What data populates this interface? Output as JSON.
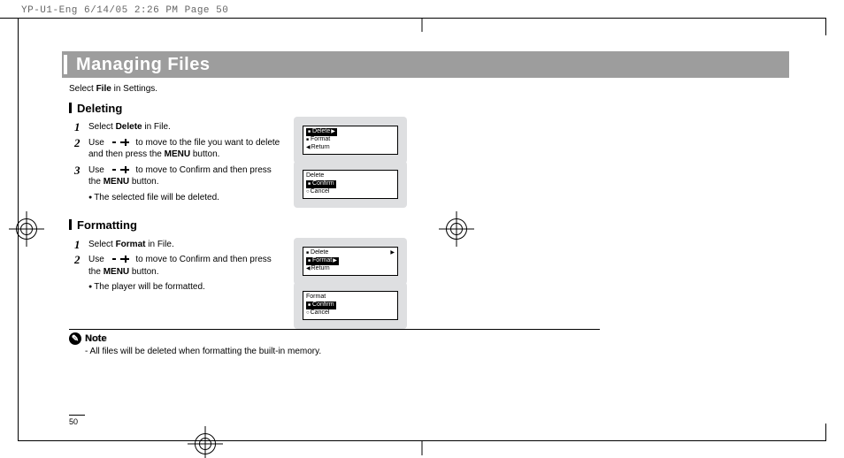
{
  "slug": "YP-U1-Eng  6/14/05 2:26 PM  Page 50",
  "title": "Managing Files",
  "intro_pre": "Select ",
  "intro_bold": "File",
  "intro_post": " in Settings.",
  "sec1_head": "Deleting",
  "sec1_step1_pre": "Select ",
  "sec1_step1_bold": "Delete",
  "sec1_step1_post": " in File.",
  "sec1_step2_pre": "Use ",
  "sec1_step2_mid": " to move to the file you want to delete and then press the ",
  "sec1_step2_bold": "MENU",
  "sec1_step2_post": " button.",
  "sec1_step3_pre": "Use ",
  "sec1_step3_mid": " to move to Confirm and then press the ",
  "sec1_step3_bold": "MENU",
  "sec1_step3_post": " button.",
  "sec1_note": "The selected file will be deleted.",
  "sec2_head": "Formatting",
  "sec2_step1_pre": "Select ",
  "sec2_step1_bold": "Format",
  "sec2_step1_post": " in File.",
  "sec2_step2_pre": "Use ",
  "sec2_step2_mid": " to move to Confirm and then press the ",
  "sec2_step2_bold": "MENU",
  "sec2_step2_post": " button.",
  "sec2_note": "The player will be formatted.",
  "note_label": "Note",
  "note_body": "- All files will be deleted when formatting the built-in memory.",
  "lcd1_r1": "Delete",
  "lcd1_r2": "Format",
  "lcd1_r3": "Return",
  "lcd2_r1": "Delete",
  "lcd2_r2": "Confirm",
  "lcd2_r3": "Cancel",
  "lcd3_r1": "Delete",
  "lcd3_r2": "Format",
  "lcd3_r3": "Return",
  "lcd4_r1": "Format",
  "lcd4_r2": "Confirm",
  "lcd4_r3": "Cancel",
  "num1": "1",
  "num2": "2",
  "num3": "3",
  "folio": "50"
}
